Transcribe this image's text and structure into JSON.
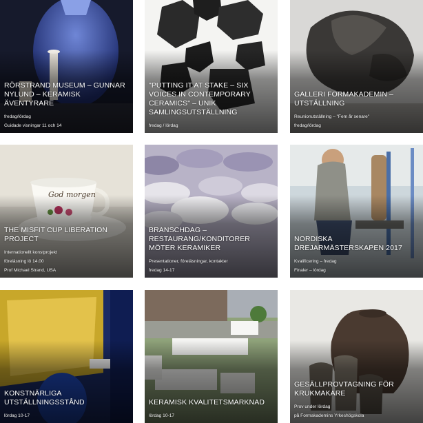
{
  "tiles": [
    {
      "title": "RÖRSTRAND MUSEUM – GUNNAR NYLUND – KERAMISK ÄVENTYRARE",
      "lines": [
        "fredag/lördag",
        "Guidade visningar 11 och 14"
      ]
    },
    {
      "title": "\"PUTTING IT AT STAKE – SIX VOICES IN CONTEMPORARY CERAMICS\" – UNIK SAMLINGSUTSTÄLLNING",
      "lines": [
        "fredag / lördag"
      ]
    },
    {
      "title": "GALLERI FORMAKADEMIN – UTSTÄLLNING",
      "lines": [
        "Reunionutställning – \"Fem år senare\"",
        "fredag/lördag"
      ]
    },
    {
      "title": "THE MISFIT CUP LIBERATION PROJECT",
      "lines": [
        "Internationellt konstprojekt",
        "föreläsning lö 14.00",
        "Prof Michael Strand, USA"
      ]
    },
    {
      "title": "BRANSCHDAG – RESTAURANG/KONDITORER MÖTER KERAMIKER",
      "lines": [
        "Presentationer, föreläsningar, kontakter",
        "fredag 14-17"
      ]
    },
    {
      "title": "NORDISKA DREJARMÄSTERSKAPEN 2017",
      "lines": [
        "Kvalificering – fredag",
        "Finaler – lördag"
      ]
    },
    {
      "title": "KONSTNÄRLIGA UTSTÄLLNINGSSTÅND",
      "lines": [
        "lördag 10-17"
      ]
    },
    {
      "title": "KERAMISK KVALITETSMARKNAD",
      "lines": [
        "lördag 10-17"
      ]
    },
    {
      "title": "GESÄLLPROVTAGNING FÖR KRUKMAKARE",
      "lines": [
        "Prov under lördag",
        "på Formakademins Yrkeshögskola"
      ]
    }
  ],
  "art": [
    {
      "icon": "blue-vase-image"
    },
    {
      "icon": "black-stones-image"
    },
    {
      "icon": "dark-sculpture-image"
    },
    {
      "icon": "teacup-image"
    },
    {
      "icon": "stacked-bowls-image"
    },
    {
      "icon": "potter-at-wheel-image"
    },
    {
      "icon": "yellow-stand-image"
    },
    {
      "icon": "market-tents-image"
    },
    {
      "icon": "clay-pots-image"
    }
  ],
  "cup_text": "God morgen"
}
